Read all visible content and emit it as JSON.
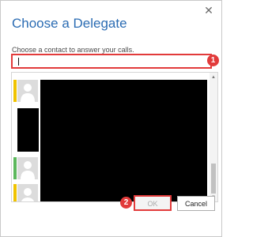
{
  "dialog": {
    "title": "Choose a Delegate",
    "close_icon": "close-icon",
    "subtitle": "Choose a contact to answer your calls."
  },
  "search": {
    "value": "",
    "placeholder": ""
  },
  "callouts": {
    "one": "1",
    "two": "2"
  },
  "contacts": [
    {
      "presence_color": "#f0c300",
      "avatar_icon": "person-icon"
    },
    {
      "presence_color": "",
      "avatar_icon": ""
    },
    {
      "presence_color": "#5cb85c",
      "avatar_icon": "person-icon"
    },
    {
      "presence_color": "#f0c300",
      "avatar_icon": "person-icon"
    }
  ],
  "buttons": {
    "ok": "OK",
    "cancel": "Cancel"
  },
  "colors": {
    "title": "#2b6cb3",
    "highlight": "#e23b3b",
    "redaction": "#000000"
  }
}
